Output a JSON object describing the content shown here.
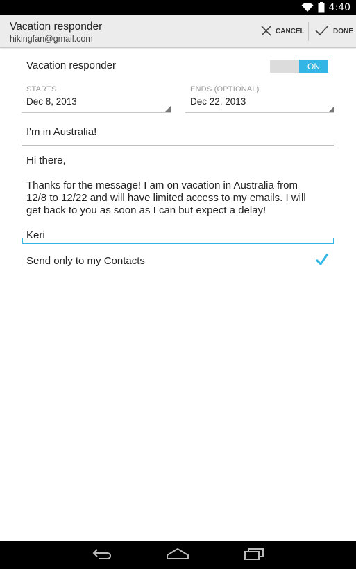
{
  "status_bar": {
    "time": "4:40",
    "icons": [
      "wifi-icon",
      "battery-icon"
    ]
  },
  "action_bar": {
    "title": "Vacation responder",
    "subtitle": "hikingfan@gmail.com",
    "cancel_label": "CANCEL",
    "done_label": "DONE",
    "icons": [
      "close-icon",
      "check-icon"
    ]
  },
  "responder": {
    "label": "Vacation responder",
    "switch_state": "ON",
    "accent_color": "#33b5e5"
  },
  "dates": {
    "starts_label": "STARTS",
    "starts_value": "Dec 8, 2013",
    "ends_label": "ENDS (OPTIONAL)",
    "ends_value": "Dec 22, 2013"
  },
  "message": {
    "subject": "I'm in Australia!",
    "body_lines": [
      "Hi there,",
      "Thanks for the message! I am on vacation in Australia from",
      "12/8 to 12/22 and will have limited access to my emails. I will",
      "get back to you as soon as I can but expect a delay!",
      "Keri"
    ]
  },
  "contacts": {
    "label": "Send only to my Contacts",
    "checked": true
  },
  "nav_bar": {
    "icons": [
      "back-icon",
      "home-icon",
      "recent-apps-icon"
    ]
  }
}
